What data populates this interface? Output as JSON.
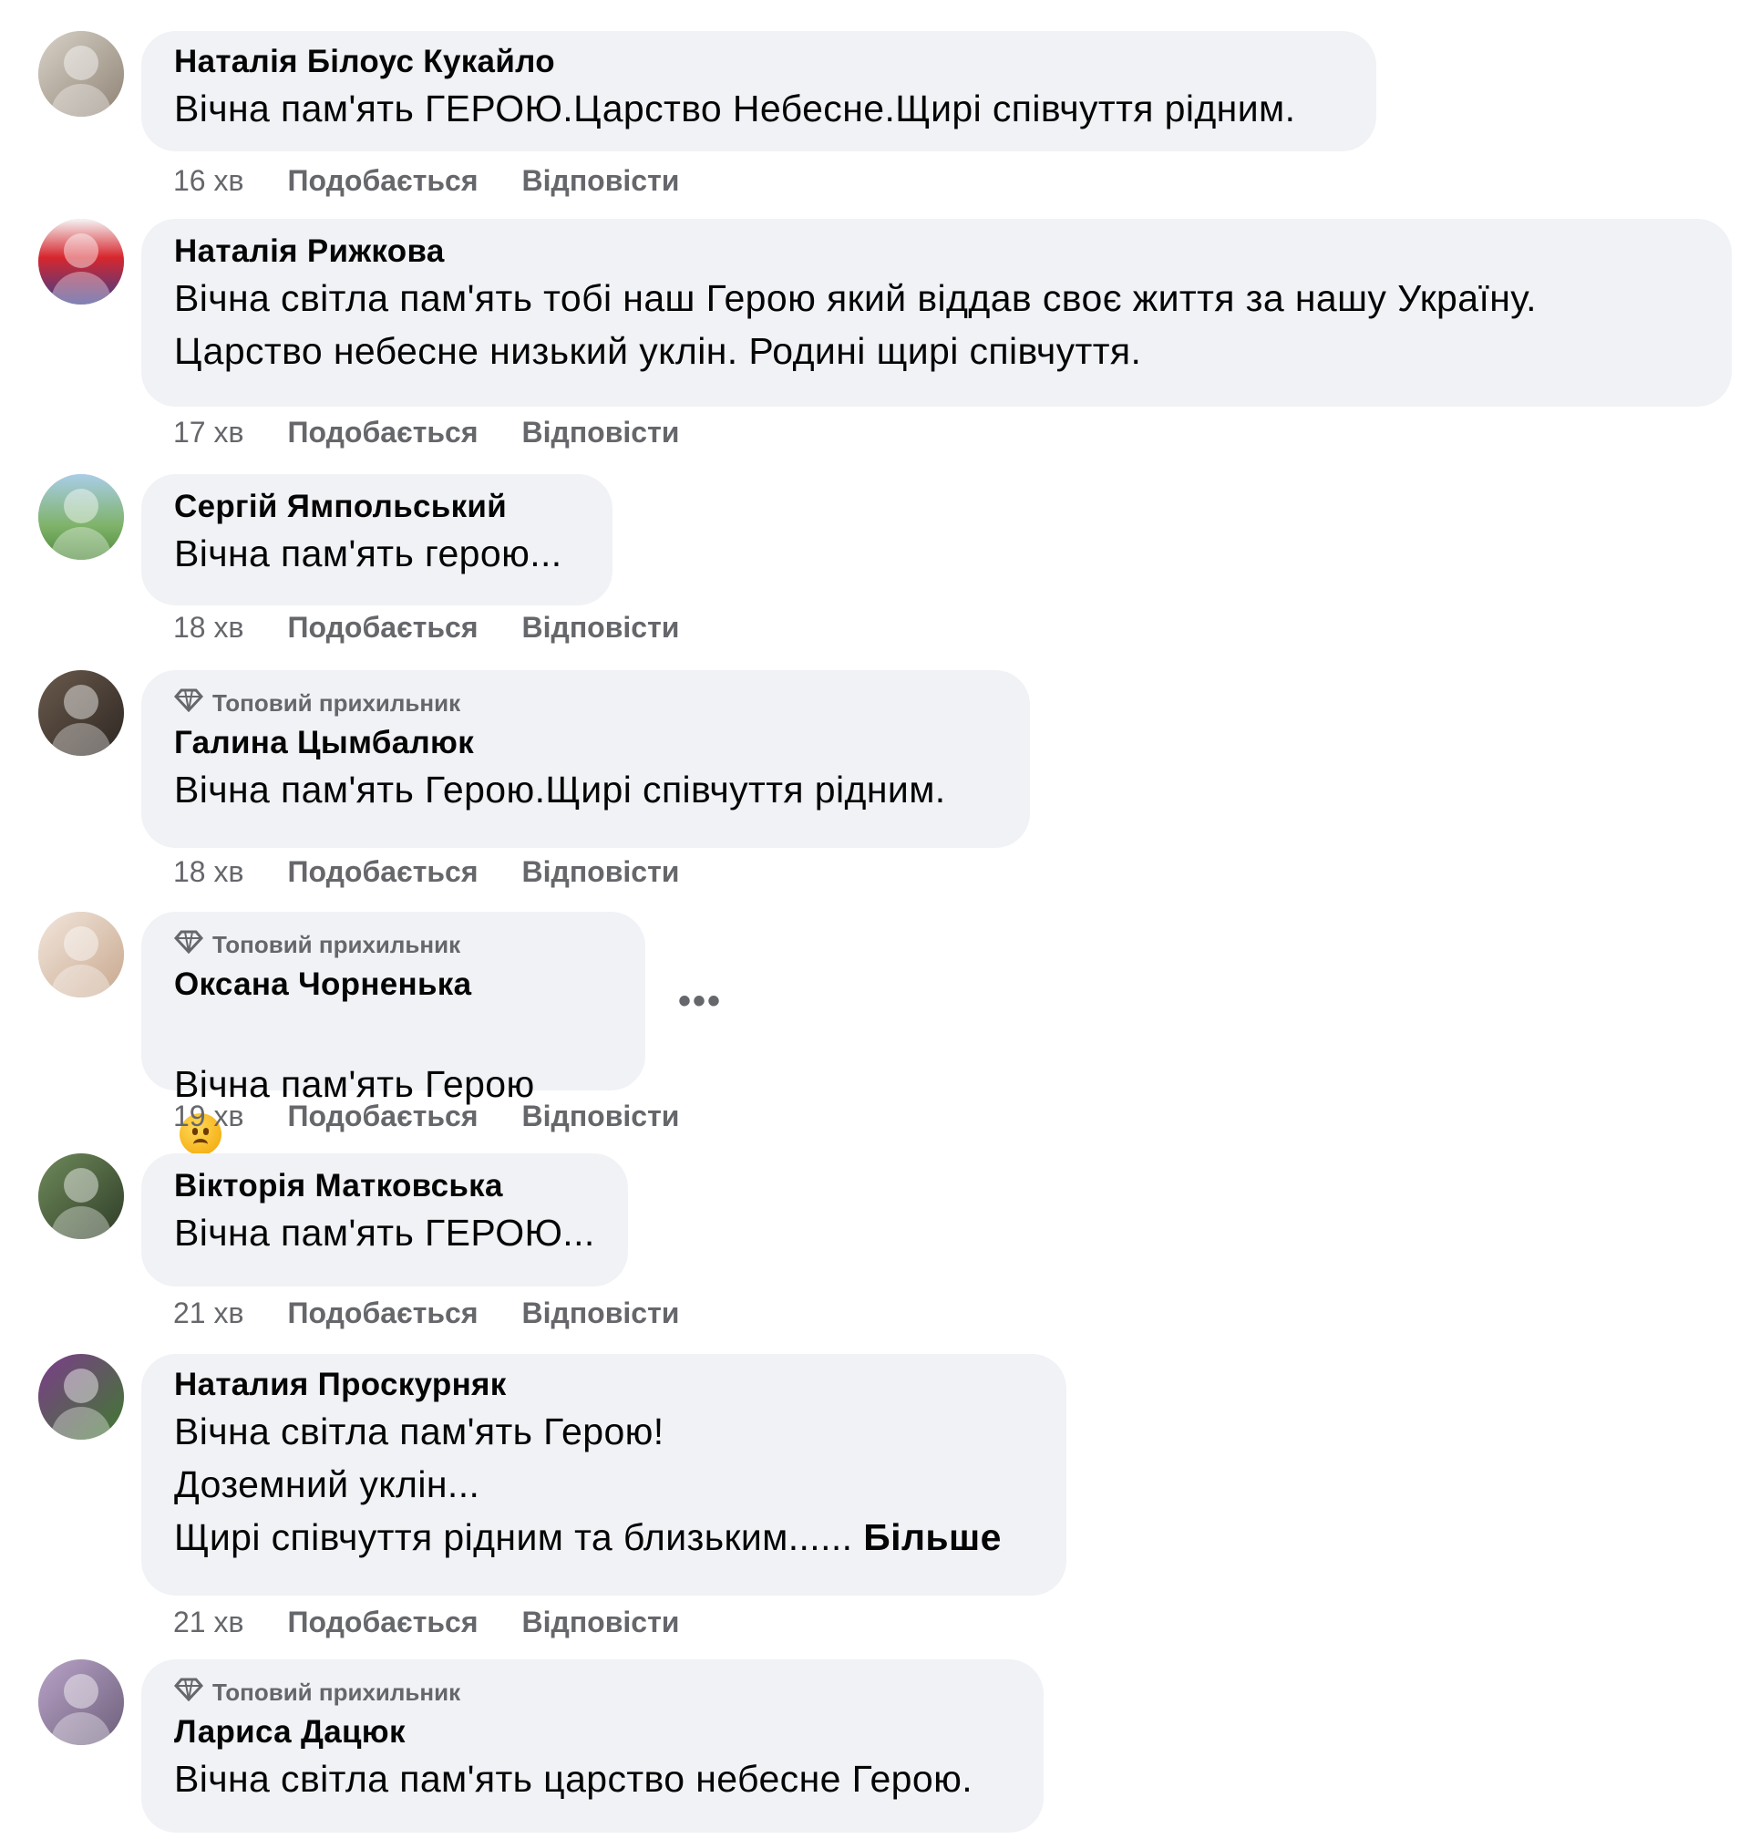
{
  "actions": {
    "like": "Подобається",
    "reply": "Відповісти"
  },
  "badge_label": "Топовий прихильник",
  "more_options": "•••",
  "comments": [
    {
      "author": "Наталія Білоус Кукайло",
      "text": "Вічна пам'ять ГЕРОЮ.Царство Небесне.Щирі співчуття рідним.",
      "time": "16 хв"
    },
    {
      "author": "Наталія Рижкова",
      "text": "Вічна світла пам'ять тобі наш Герою який віддав своє життя за нашу Україну.\nЦарство небесне низький уклін. Родині щирі співчуття.",
      "time": "17 хв"
    },
    {
      "author": "Сергій Ямпольський",
      "text": "Вічна пам'ять герою...",
      "time": "18 хв"
    },
    {
      "author": "Галина Цымбалюк",
      "top_fan": true,
      "text": "Вічна пам'ять Герою.Щирі співчуття рідним.",
      "time": "18 хв"
    },
    {
      "author": "Оксана Чорненька",
      "top_fan": true,
      "text": "Вічна пам'ять Герою",
      "emoji": "sad-face-emoji",
      "time": "19 хв"
    },
    {
      "author": "Вікторія Матковська",
      "text": "Вічна пам'ять ГЕРОЮ...",
      "time": "21 хв"
    },
    {
      "author": "Наталия Проскурняк",
      "text": "Вічна світла пам'ять Герою!\nДоземний уклін...\nЩирі співчуття рідним та близьким......",
      "more": "Більше",
      "time": "21 хв"
    },
    {
      "author": "Лариса Дацюк",
      "top_fan": true,
      "text": "Вічна світла пам'ять царство небесне Герою."
    }
  ],
  "colors": {
    "bubble": "#f0f2f5",
    "secondary_text": "#65676b",
    "primary_text": "#050505"
  }
}
